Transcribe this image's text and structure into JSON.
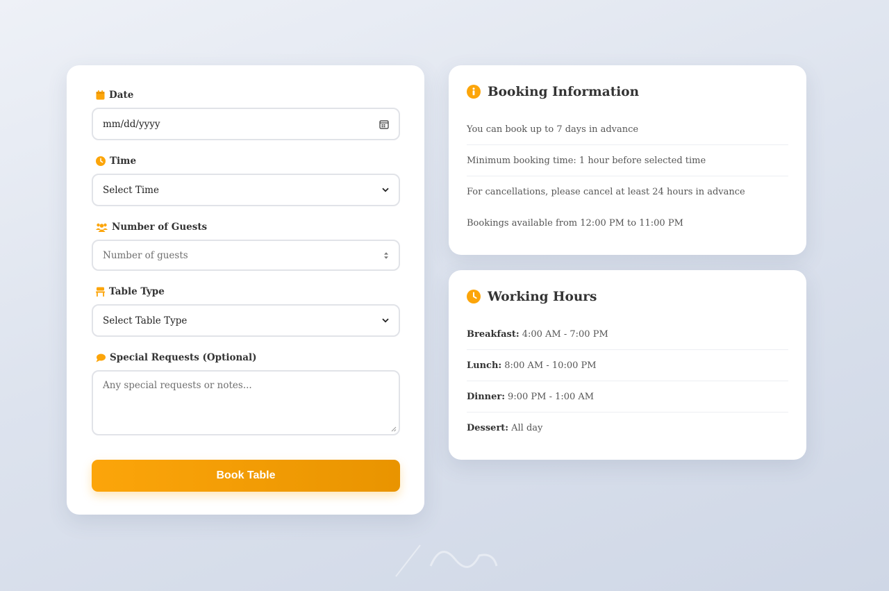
{
  "form": {
    "date": {
      "label": "Date",
      "placeholder": "mm/dd/yyyy"
    },
    "time": {
      "label": "Time",
      "selected": "Select Time"
    },
    "guests": {
      "label": "Number of Guests",
      "placeholder": "Number of guests"
    },
    "table_type": {
      "label": "Table Type",
      "selected": "Select Table Type"
    },
    "requests": {
      "label": "Special Requests (Optional)",
      "placeholder": "Any special requests or notes..."
    },
    "submit_label": "Book Table"
  },
  "booking_info": {
    "title": "Booking Information",
    "items": [
      "You can book up to 7 days in advance",
      "Minimum booking time: 1 hour before selected time",
      "For cancellations, please cancel at least 24 hours in advance",
      "Bookings available from 12:00 PM to 11:00 PM"
    ]
  },
  "working_hours": {
    "title": "Working Hours",
    "items": [
      {
        "meal": "Breakfast:",
        "hours": "4:00 AM - 7:00 PM"
      },
      {
        "meal": "Lunch:",
        "hours": "8:00 AM - 10:00 PM"
      },
      {
        "meal": "Dinner:",
        "hours": "9:00 PM - 1:00 AM"
      },
      {
        "meal": "Dessert:",
        "hours": "All day"
      }
    ]
  },
  "colors": {
    "accent": "#fca50a",
    "accent_dark": "#e99400",
    "border": "#e1e3e8"
  },
  "icons": {
    "date": "calendar-icon",
    "time": "clock-icon",
    "guests": "users-icon",
    "table_type": "chair-icon",
    "requests": "comment-icon",
    "info": "info-circle-icon",
    "hours": "clock-icon"
  }
}
